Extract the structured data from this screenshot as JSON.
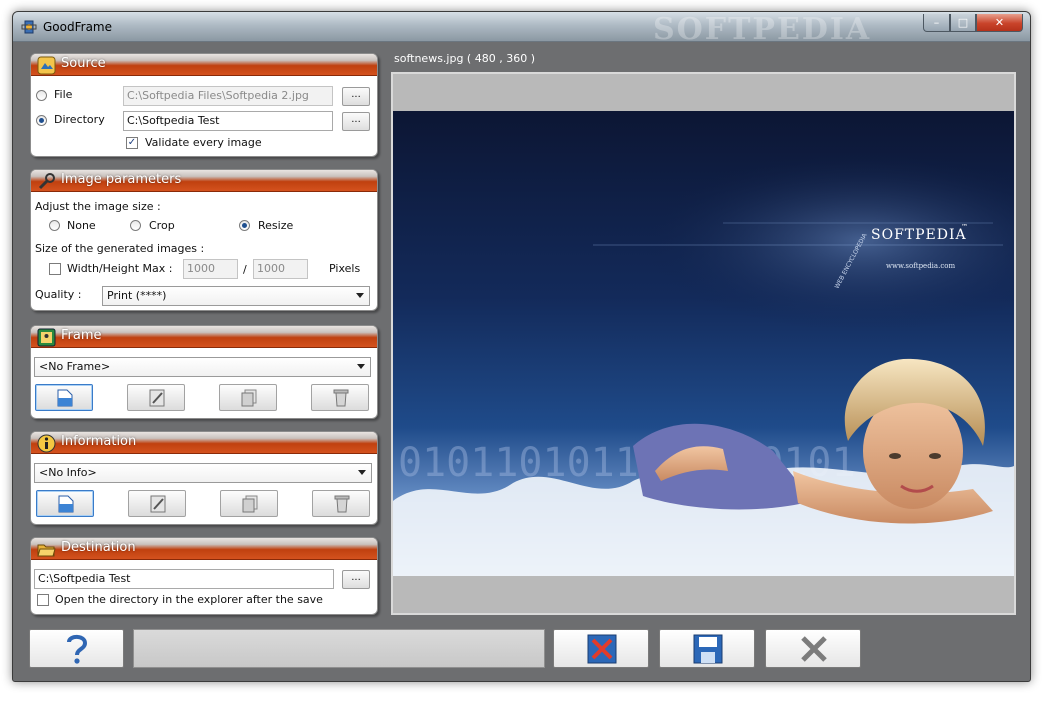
{
  "window": {
    "title": "GoodFrame",
    "watermark": "SOFTPEDIA",
    "buttons": {
      "minimize": "–",
      "maximize": "□",
      "close": "✕"
    }
  },
  "source": {
    "title": "Source",
    "file_label": "File",
    "file_value": "C:\\Softpedia Files\\Softpedia 2.jpg",
    "directory_label": "Directory",
    "directory_value": "C:\\Softpedia Test",
    "browse_label": "...",
    "validate_label": "Validate every image",
    "validate_checked": true,
    "mode": "Directory"
  },
  "image_parameters": {
    "title": "Image parameters",
    "adjust_label": "Adjust the image size :",
    "options": [
      "None",
      "Crop",
      "Resize"
    ],
    "selected": "Resize",
    "size_label": "Size of the generated images :",
    "max_label": "Width/Height Max :",
    "width_value": "1000",
    "height_value": "1000",
    "separator": "/",
    "unit": "Pixels",
    "quality_label": "Quality :",
    "quality_value": "Print (****)"
  },
  "frame": {
    "title": "Frame",
    "selected": "<No Frame>"
  },
  "information": {
    "title": "Information",
    "selected": "<No Info>"
  },
  "destination": {
    "title": "Destination",
    "path": "C:\\Softpedia Test",
    "browse_label": "...",
    "open_label": "Open the directory in the explorer after the save",
    "open_checked": false
  },
  "preview": {
    "filename": "softnews.jpg ( 480 , 360 )",
    "logo_text": "SOFTPEDIA",
    "logo_tm": "™",
    "url_text": "www.softpedia.com",
    "side_text": "WEB ENCYCLOPEDIA",
    "binary_text": "0101101011010110101"
  },
  "colors": {
    "header_orange": "#c9461a",
    "window_bg": "#6d6e70",
    "accent_blue": "#1f4f8f"
  },
  "icons": {
    "help": "question-mark-icon",
    "cancel": "cancel-x-icon",
    "save": "floppy-disk-icon",
    "exit": "close-x-icon"
  }
}
